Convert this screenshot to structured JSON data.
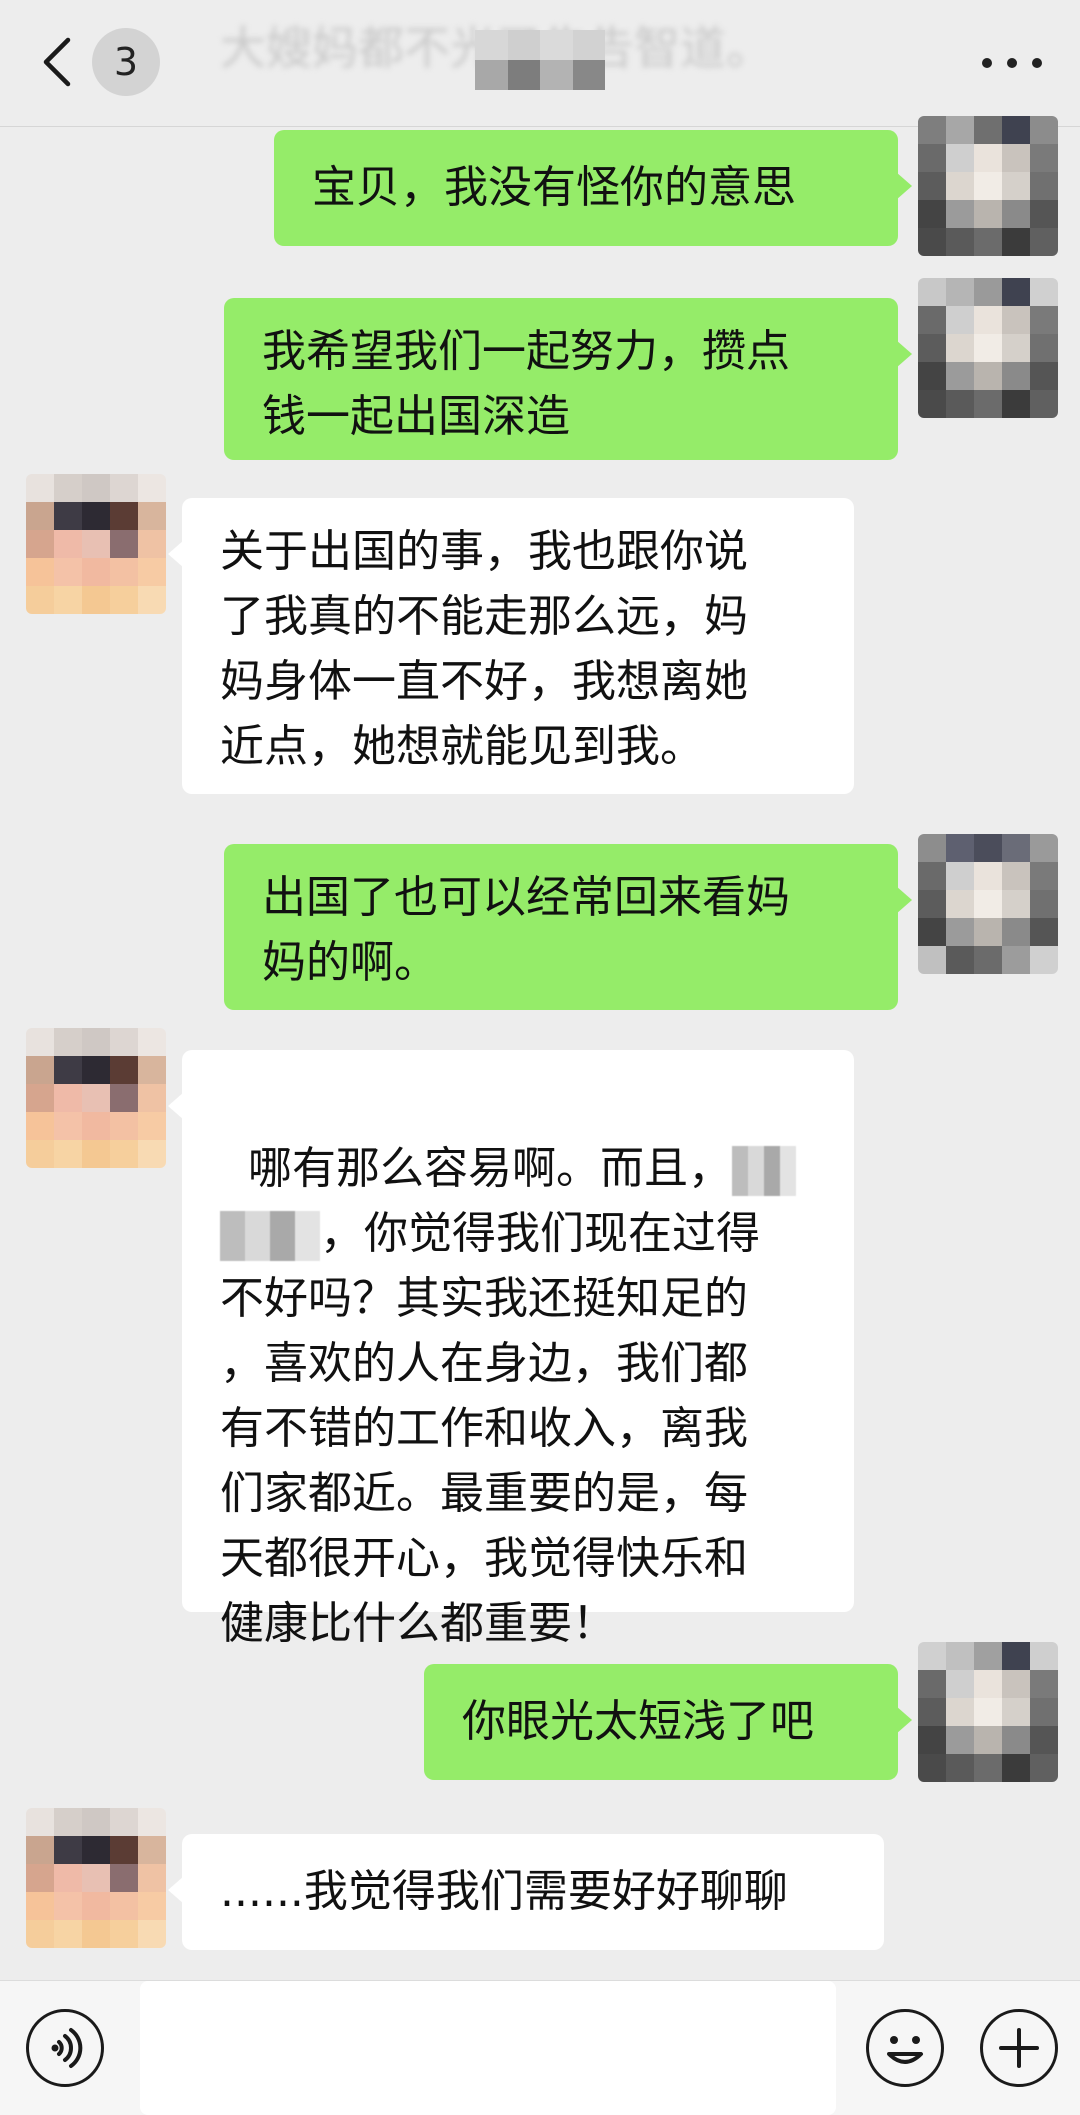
{
  "header": {
    "back_count": "3",
    "title": "大嫂妈都不光了告告智道。",
    "more_icon": "more-dots-icon"
  },
  "messages": [
    {
      "side": "me",
      "text": "宝贝，我没有怪你的意思"
    },
    {
      "side": "me",
      "text": "我希望我们一起努力，攒点\n钱一起出国深造"
    },
    {
      "side": "other",
      "text": "关于出国的事，我也跟你说\n了我真的不能走那么远，妈\n妈身体一直不好，我想离她\n近点，她想就能见到我。"
    },
    {
      "side": "me",
      "text": "出国了也可以经常回来看妈\n妈的啊。"
    },
    {
      "side": "other",
      "text_first": "哪有那么容易啊。而且，",
      "text_second": "，你觉得我们现在过得",
      "text_rest": "不好吗？其实我还挺知足的\n，喜欢的人在身边，我们都\n有不错的工作和收入，离我\n们家都近。最重要的是，每\n天都很开心，我觉得快乐和\n健康比什么都重要！"
    },
    {
      "side": "me",
      "text": "你眼光太短浅了吧"
    },
    {
      "side": "other",
      "text": "......我觉得我们需要好好聊聊"
    }
  ],
  "colors": {
    "background": "#ededed",
    "my_bubble": "#95ec69",
    "other_bubble": "#ffffff"
  },
  "bottom_bar": {
    "voice_icon": "voice-icon",
    "emoji_icon": "emoji-icon",
    "plus_icon": "plus-icon",
    "input_value": ""
  }
}
